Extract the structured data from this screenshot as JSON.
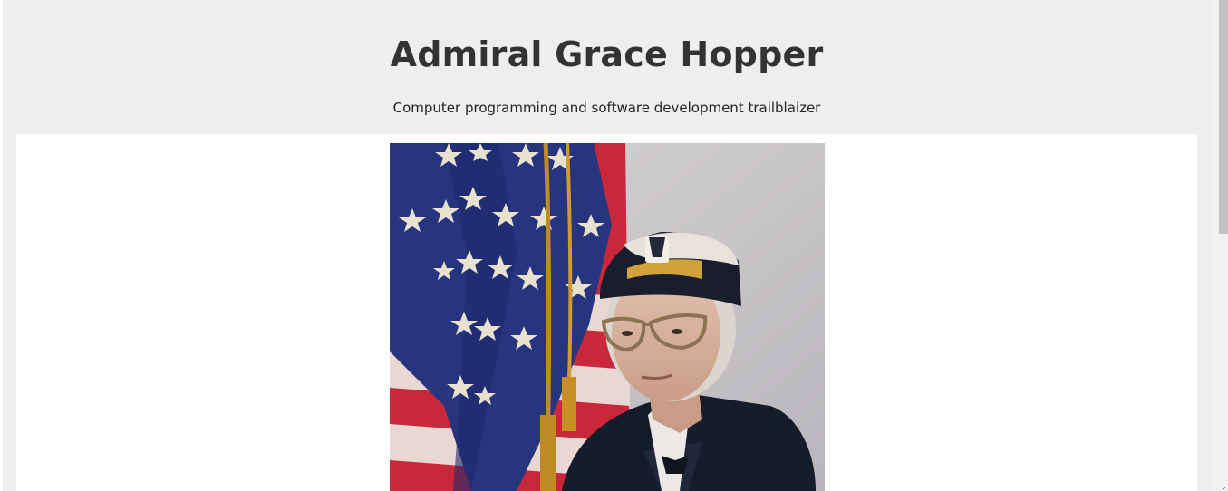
{
  "header": {
    "title": "Admiral Grace Hopper",
    "subtitle": "Computer programming and software development trailblaizer"
  },
  "image": {
    "alt": "Admiral Grace Hopper"
  },
  "icons": {
    "scroll_down": "chevron-down-icon"
  },
  "colors": {
    "page_background": "#eeeeee",
    "image_panel": "#ffffff",
    "title_text": "#333333"
  }
}
